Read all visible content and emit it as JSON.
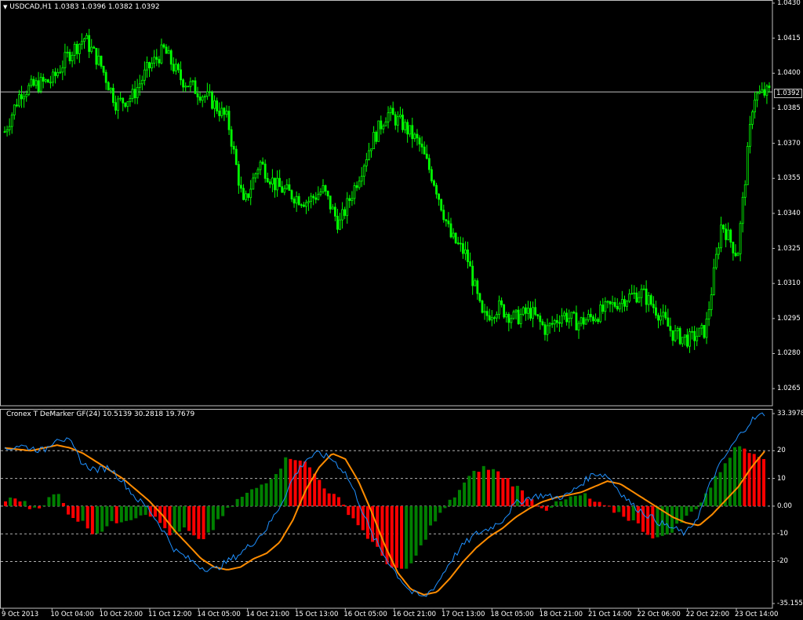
{
  "main_chart": {
    "header_symbol": "USDCAD,H1",
    "header_ohlc": "1.0383 1.0396 1.0382 1.0392",
    "current_price_label": "1.0392",
    "current_price": 1.0392
  },
  "indicator": {
    "header": "Cronex T DeMarker GF(24) 10.5139 30.2818 19.7679"
  },
  "colors": {
    "background": "#000000",
    "candles": "#00ff00",
    "hist_up": "#008000",
    "hist_down": "#ff0000",
    "fast_line": "#1e90ff",
    "slow_line": "#ff8c00",
    "grid_text": "#ffffff"
  },
  "chart_data": [
    {
      "type": "candlestick",
      "title": "USDCAD,H1",
      "ylim": [
        1.0259,
        1.043
      ],
      "y_ticks": [
        "1.0430",
        "1.0415",
        "1.0400",
        "1.0385",
        "1.0370",
        "1.0355",
        "1.0340",
        "1.0325",
        "1.0310",
        "1.0295",
        "1.0280",
        "1.0265"
      ],
      "x_tick_labels": [
        "9 Oct 2013",
        "10 Oct 04:00",
        "10 Oct 20:00",
        "11 Oct 12:00",
        "14 Oct 05:00",
        "14 Oct 21:00",
        "15 Oct 13:00",
        "16 Oct 05:00",
        "16 Oct 21:00",
        "17 Oct 13:00",
        "18 Oct 05:00",
        "18 Oct 21:00",
        "21 Oct 14:00",
        "22 Oct 06:00",
        "22 Oct 22:00",
        "23 Oct 14:00"
      ],
      "close_path": [
        1.0375,
        1.0392,
        1.0395,
        1.0397,
        1.0408,
        1.0415,
        1.0404,
        1.0387,
        1.039,
        1.0402,
        1.041,
        1.0398,
        1.0393,
        1.0388,
        1.038,
        1.0343,
        1.0362,
        1.0352,
        1.0348,
        1.0345,
        1.035,
        1.0335,
        1.0352,
        1.037,
        1.0383,
        1.0378,
        1.037,
        1.0353,
        1.033,
        1.0322,
        1.0295,
        1.03,
        1.0295,
        1.0298,
        1.029,
        1.0297,
        1.0293,
        1.0296,
        1.03,
        1.0304,
        1.0306,
        1.0298,
        1.0288,
        1.0286,
        1.029,
        1.0336,
        1.0322,
        1.039,
        1.0392
      ]
    },
    {
      "type": "histogram+line",
      "title": "Cronex T DeMarker GF(24)",
      "ylim": [
        -35.1555,
        33.3978
      ],
      "y_ticks": [
        "33.3978",
        "20",
        "10",
        "0.00",
        "-10",
        "-20",
        "-35.1555"
      ],
      "levels": [
        20,
        10,
        0,
        -10,
        -20
      ],
      "histogram_path": [
        2,
        3,
        -1,
        1,
        5,
        -3,
        -6,
        -10,
        -7,
        -5,
        -4,
        -2,
        -6,
        -11,
        -8,
        -13,
        -9,
        -3,
        2,
        5,
        8,
        12,
        18,
        17,
        12,
        6,
        2,
        -4,
        -10,
        -16,
        -22,
        -24,
        -18,
        -8,
        -2,
        4,
        10,
        14,
        13,
        10,
        6,
        2,
        -1,
        1,
        3,
        4,
        1,
        -1,
        -3,
        -6,
        -10,
        -12,
        -8,
        -4,
        1,
        8,
        16,
        22,
        20,
        18
      ],
      "fast_line_path": [
        20,
        22,
        21,
        20,
        25,
        23,
        15,
        13,
        14,
        9,
        3,
        -1,
        -8,
        -16,
        -19,
        -22,
        -23,
        -20,
        -17,
        -13,
        -8,
        0,
        10,
        17,
        19,
        17,
        12,
        2,
        -10,
        -18,
        -25,
        -31,
        -33,
        -28,
        -20,
        -14,
        -10,
        -8,
        -5,
        1,
        3,
        4,
        3,
        4,
        8,
        12,
        11,
        5,
        0,
        -3,
        -6,
        -8,
        -10,
        -3,
        10,
        18,
        25,
        31,
        33.3978
      ],
      "slow_line_path": [
        21,
        20.5,
        20,
        21,
        22,
        21,
        19,
        16,
        13,
        10,
        6,
        2,
        -3,
        -9,
        -14,
        -19,
        -22,
        -23,
        -22,
        -19,
        -17,
        -13,
        -5,
        6,
        14,
        19,
        17,
        9,
        -2,
        -14,
        -24,
        -30,
        -32,
        -31,
        -26,
        -20,
        -15,
        -11,
        -8,
        -4,
        -1,
        1.5,
        3,
        4,
        5,
        7,
        9,
        8,
        5,
        2,
        -1,
        -4,
        -6,
        -7,
        -3,
        2,
        7,
        14,
        19.7679
      ]
    }
  ]
}
